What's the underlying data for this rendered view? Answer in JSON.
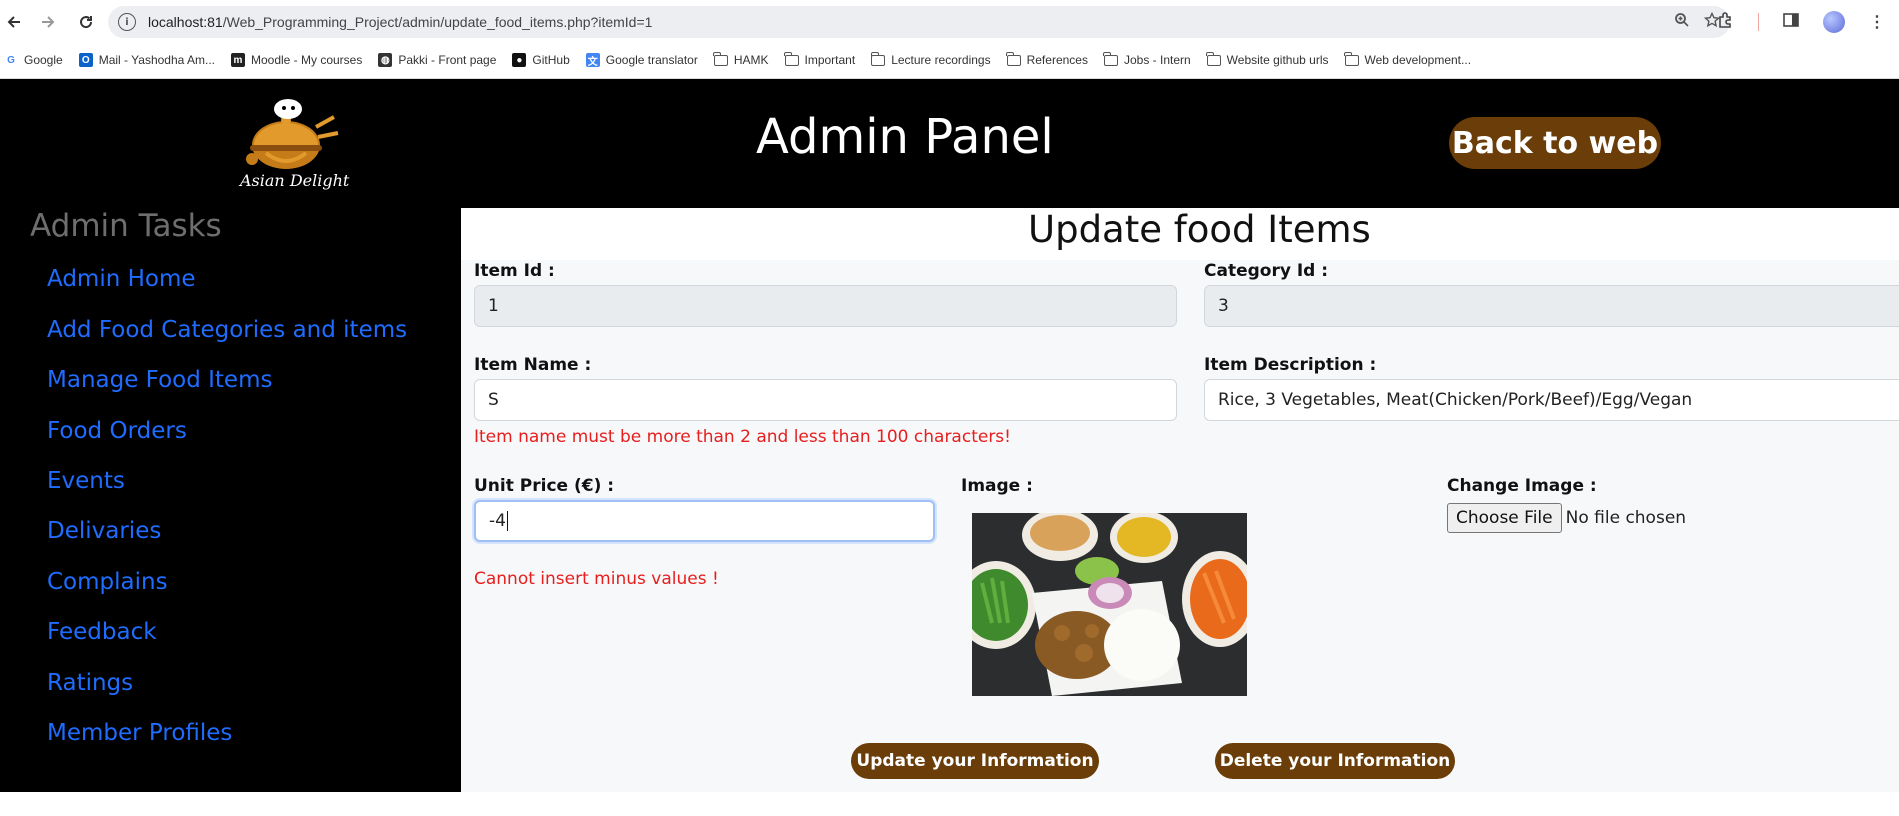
{
  "browser": {
    "url_host": "localhost:81",
    "url_path": "/Web_Programming_Project/admin/update_food_items.php?itemId=1",
    "bookmarks": [
      {
        "label": "Google",
        "icon": "google-icon"
      },
      {
        "label": "Mail - Yashodha Am...",
        "icon": "outlook-icon"
      },
      {
        "label": "Moodle - My courses",
        "icon": "moodle-icon"
      },
      {
        "label": "Pakki - Front page",
        "icon": "globe-icon"
      },
      {
        "label": "GitHub",
        "icon": "github-icon"
      },
      {
        "label": "Google translator",
        "icon": "translate-icon"
      },
      {
        "label": "HAMK",
        "icon": "folder-icon"
      },
      {
        "label": "Important",
        "icon": "folder-icon"
      },
      {
        "label": "Lecture recordings",
        "icon": "folder-icon"
      },
      {
        "label": "References",
        "icon": "folder-icon"
      },
      {
        "label": "Jobs - Intern",
        "icon": "folder-icon"
      },
      {
        "label": "Website github urls",
        "icon": "folder-icon"
      },
      {
        "label": "Web development...",
        "icon": "folder-icon"
      }
    ]
  },
  "header": {
    "logo_text": "Asian Delight",
    "title": "Admin Panel",
    "back_button": "Back to web"
  },
  "sidebar": {
    "title": "Admin Tasks",
    "items": [
      {
        "label": "Admin Home"
      },
      {
        "label": "Add Food Categories and items"
      },
      {
        "label": "Manage Food Items"
      },
      {
        "label": "Food Orders"
      },
      {
        "label": "Events"
      },
      {
        "label": "Delivaries"
      },
      {
        "label": "Complains"
      },
      {
        "label": "Feedback"
      },
      {
        "label": "Ratings"
      },
      {
        "label": "Member Profiles"
      }
    ]
  },
  "form": {
    "title": "Update food Items",
    "item_id": {
      "label": "Item Id :",
      "value": "1"
    },
    "category_id": {
      "label": "Category Id :",
      "value": "3"
    },
    "item_name": {
      "label": "Item Name :",
      "value": "S",
      "error": "Item name must be more than 2 and less than 100 characters!"
    },
    "item_description": {
      "label": "Item Description :",
      "value": "Rice, 3 Vegetables, Meat(Chicken/Pork/Beef)/Egg/Vegan"
    },
    "unit_price": {
      "label": "Unit Price (€) :",
      "value": "-4",
      "error": "Cannot insert minus values !"
    },
    "image": {
      "label": "Image :"
    },
    "change_image": {
      "label": "Change Image :",
      "button": "Choose File",
      "status": "No file chosen"
    },
    "update_button": "Update your Information",
    "delete_button": "Delete your Information"
  },
  "colors": {
    "brand_brown": "#6b3e09",
    "link_blue": "#1f6cff",
    "error_red": "#e61e1e",
    "header_bg": "#000000"
  }
}
